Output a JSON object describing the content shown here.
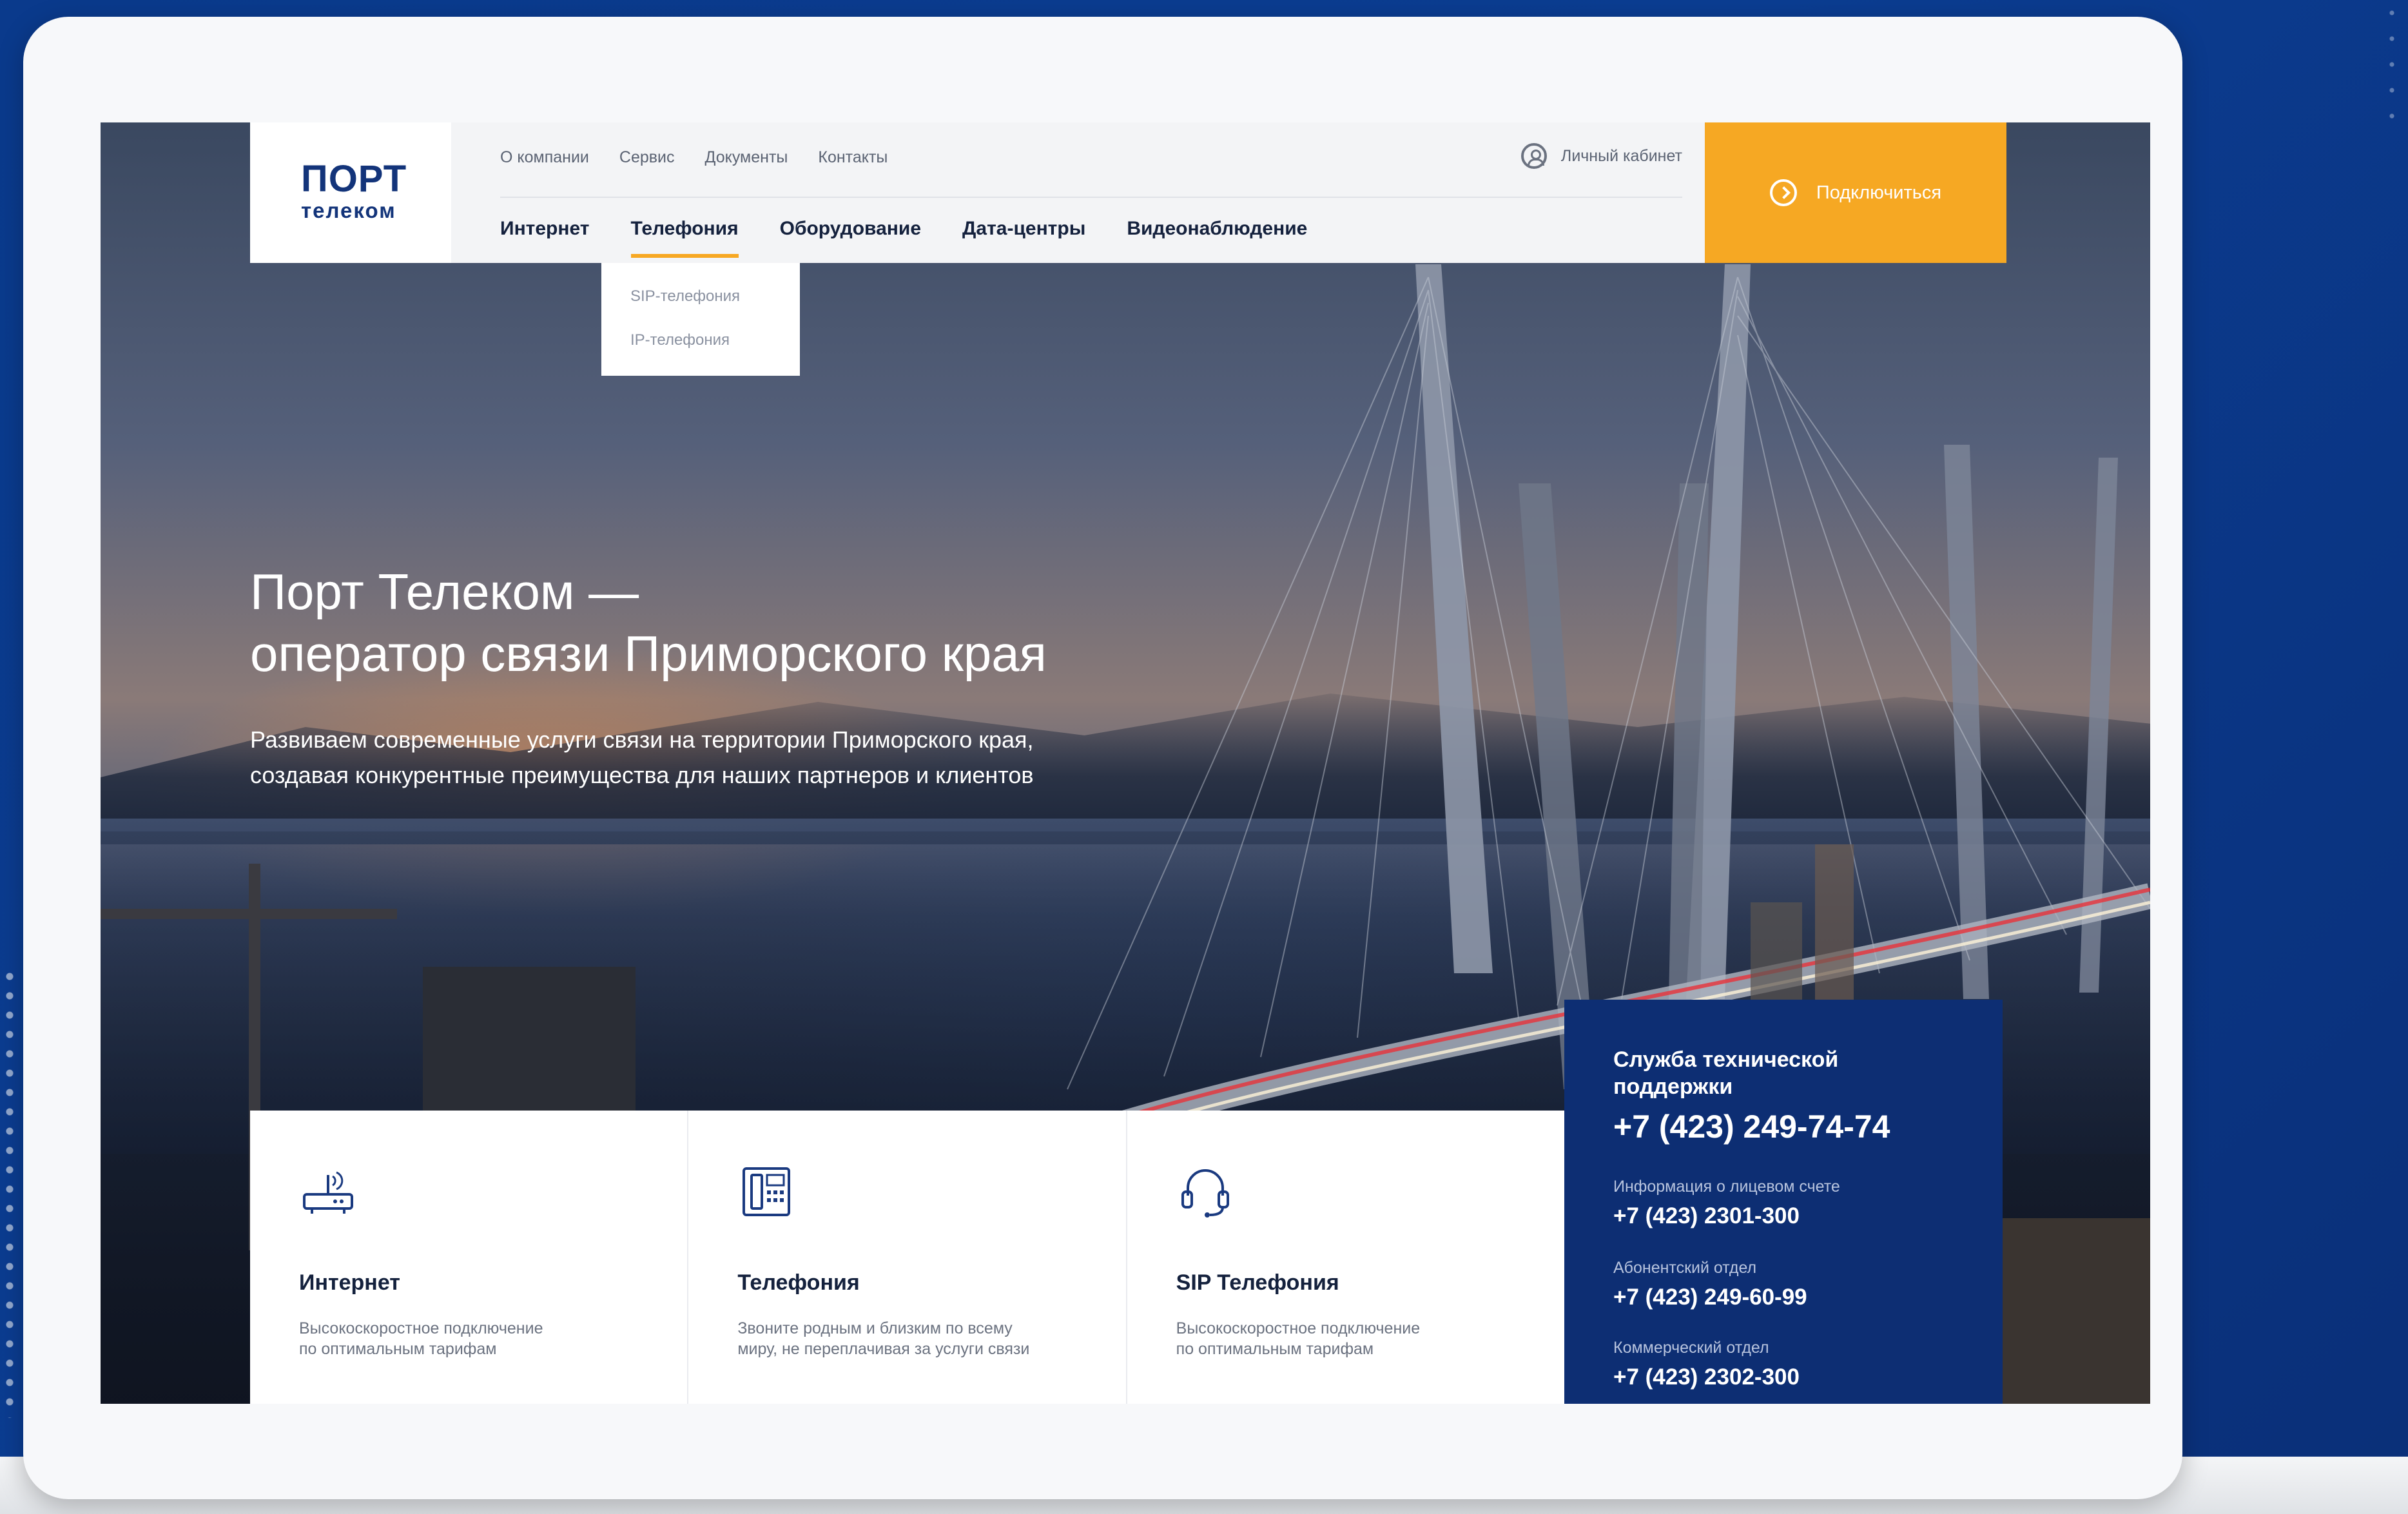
{
  "header": {
    "logo_top": "ПОРТ",
    "logo_bottom": "телеком",
    "top_links": [
      "О компании",
      "Сервис",
      "Документы",
      "Контакты"
    ],
    "account_label": "Личный кабинет",
    "main_links": [
      "Интернет",
      "Телефония",
      "Оборудование",
      "Дата-центры",
      "Видеонаблюдение"
    ],
    "active_link": "Телефония",
    "connect_label": "Подключиться"
  },
  "dropdown": {
    "items": [
      "SIP-телефония",
      "IP-телефония"
    ]
  },
  "hero": {
    "title_line1": "Порт Телеком —",
    "title_line2": "оператор связи Приморского края",
    "subtitle_line1": "Развиваем современные услуги связи на территории Приморского края,",
    "subtitle_line2": "создавая конкурентные преимущества для наших партнеров и клиентов"
  },
  "cards": [
    {
      "icon": "router-icon",
      "title": "Интернет",
      "desc_line1": "Высокоскоростное подключение",
      "desc_line2": "по оптимальным тарифам"
    },
    {
      "icon": "desk-phone-icon",
      "title": "Телефония",
      "desc_line1": "Звоните родным и близким по всему",
      "desc_line2": "миру, не переплачивая за услуги связи"
    },
    {
      "icon": "headset-icon",
      "title": "SIP Телефония",
      "desc_line1": "Высокоскоростное подключение",
      "desc_line2": "по оптимальным тарифам"
    }
  ],
  "support": {
    "title": "Служба технической поддержки",
    "phone": "+7 (423) 249-74-74",
    "contacts": [
      {
        "label": "Информация о лицевом счете",
        "phone": "+7 (423) 2301-300"
      },
      {
        "label": "Абонентский отдел",
        "phone": "+7 (423) 249-60-99"
      },
      {
        "label": "Коммерческий отдел",
        "phone": "+7 (423) 2302-300"
      }
    ]
  },
  "colors": {
    "accent": "#f6a823",
    "navy": "#0d2e73",
    "background": "#0b3d92"
  }
}
